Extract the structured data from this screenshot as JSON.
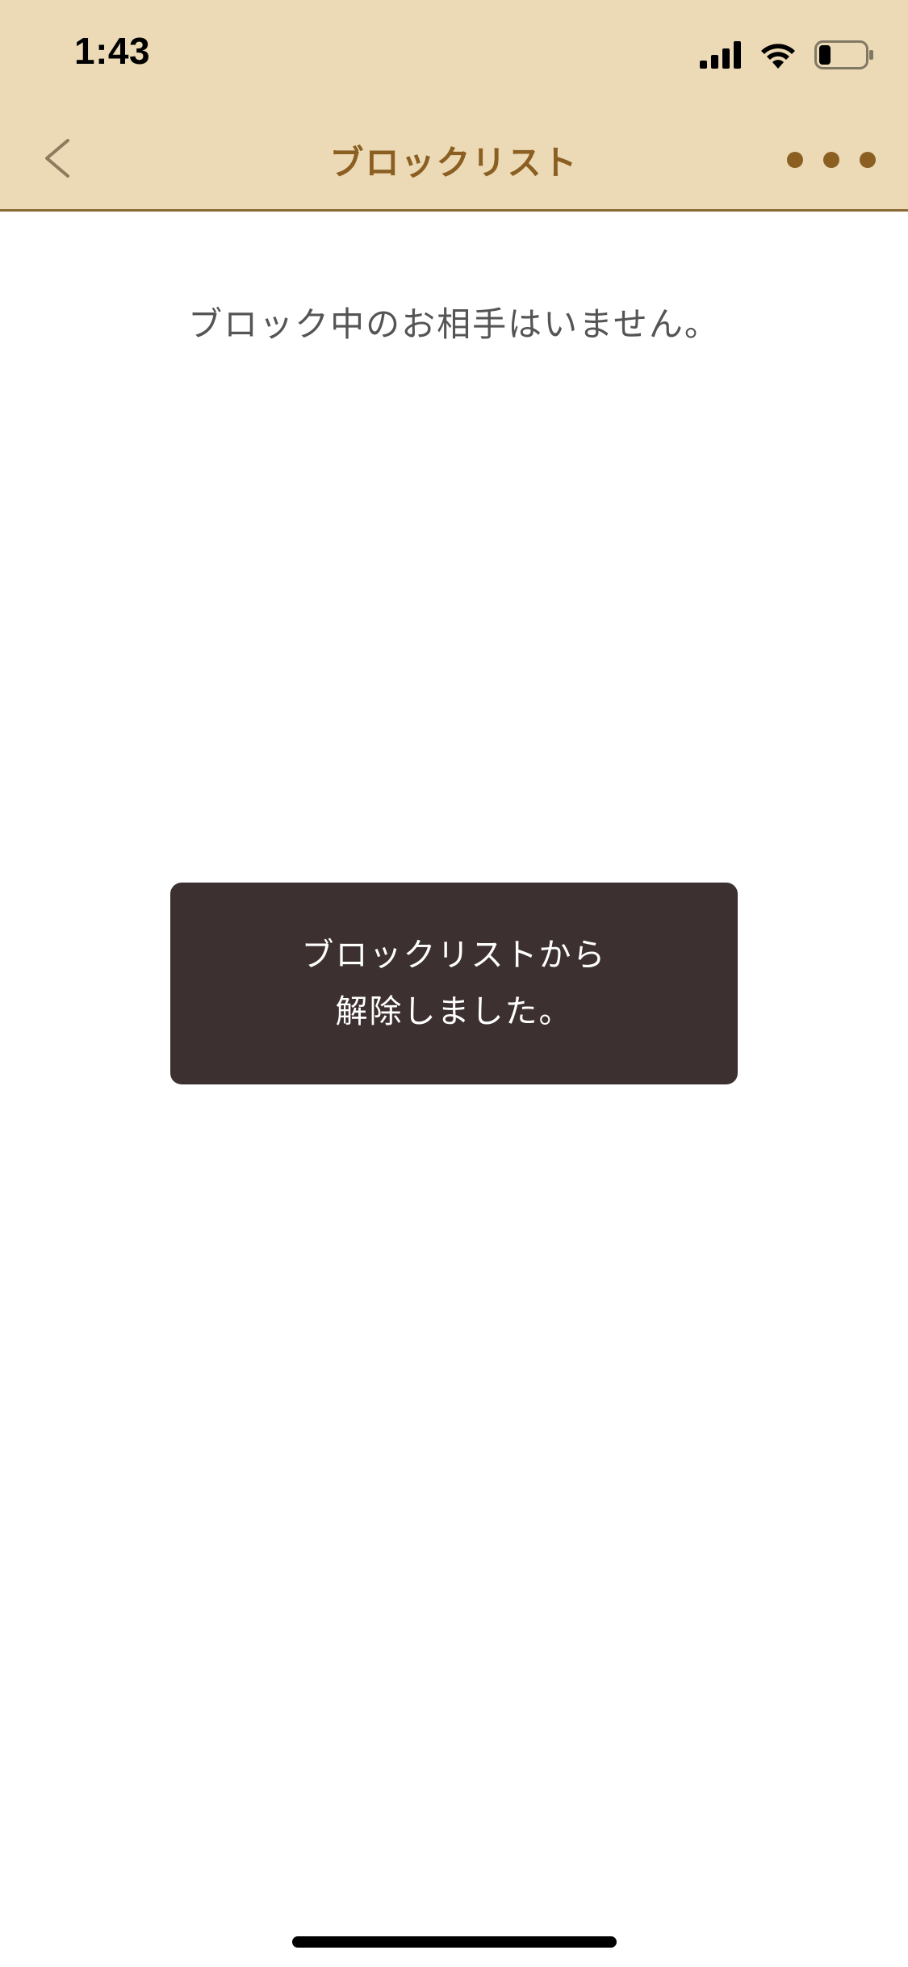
{
  "status_bar": {
    "time": "1:43",
    "icons": [
      "signal-icon",
      "wifi-icon",
      "battery-icon"
    ]
  },
  "nav": {
    "title": "ブロックリスト",
    "back_icon": "chevron-left-icon",
    "more_icon": "more-dots-icon"
  },
  "content": {
    "empty_message": "ブロック中のお相手はいません。"
  },
  "toast": {
    "line1": "ブロックリストから",
    "line2": "解除しました。"
  },
  "colors": {
    "header_bg": "#ecdab6",
    "accent": "#8b5f22",
    "toast_bg": "#3c3130"
  }
}
